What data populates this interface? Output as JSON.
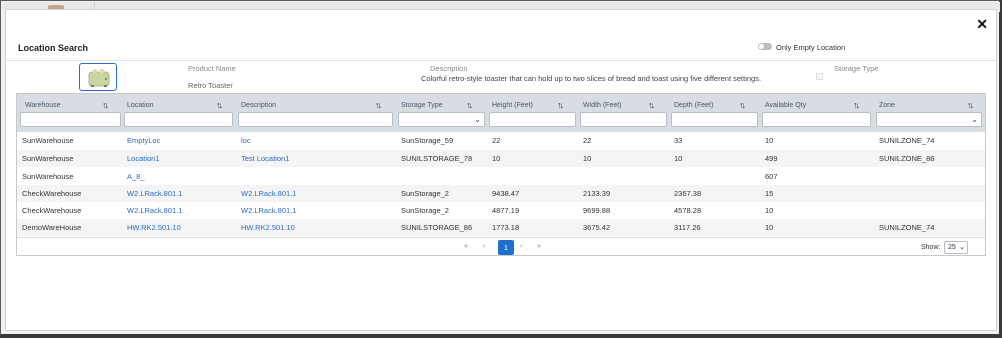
{
  "modal": {
    "title": "Location Search",
    "close_icon": "close-icon",
    "only_empty_location_label": "Only Empty Location"
  },
  "product": {
    "image_icon": "toaster-image",
    "name_label": "Product Name",
    "name_value": "Retro Toaster",
    "description_label": "Description",
    "description_value": "Colorful retro-style toaster that can hold up to two slices of bread and toast using five different settings.",
    "storage_type_label": "Storage Type"
  },
  "grid": {
    "columns": [
      "Warehouse",
      "Location",
      "Description",
      "Storage Type",
      "Height (Feet)",
      "Width (Feet)",
      "Depth (Feet)",
      "Available Qty",
      "Zone"
    ],
    "rows": [
      [
        "SunWarehouse",
        "EmptyLoc",
        "loc",
        "SunStorage_59",
        "22",
        "22",
        "33",
        "10",
        "SUNILZONE_74"
      ],
      [
        "SunWarehouse",
        "Location1",
        "Test Location1",
        "SUNILSTORAGE_78",
        "10",
        "10",
        "10",
        "499",
        "SUNILZONE_86"
      ],
      [
        "SunWarehouse",
        "A_8_",
        "",
        "",
        "",
        "",
        "",
        "607",
        ""
      ],
      [
        "CheckWarehouse",
        "W2.LRack.801.1",
        "W2.LRack.801.1",
        "SunStorage_2",
        "9438.47",
        "2133.39",
        "2367.38",
        "15",
        ""
      ],
      [
        "CheckWarehouse",
        "W2.LRack.801.1",
        "W2.LRack.801.1",
        "SunStorage_2",
        "4877.19",
        "9699.88",
        "4578.28",
        "10",
        ""
      ],
      [
        "DemoWareHouse",
        "HW.RK2.501.10",
        "HW.RK2.501.10",
        "SUNILSTORAGE_86",
        "1773.18",
        "3675.42",
        "3117.26",
        "10",
        "SUNILZONE_74"
      ]
    ]
  },
  "pager": {
    "first": "«",
    "prev": "‹",
    "current_page": "1",
    "next": "›",
    "last": "»",
    "show_label": "Show:",
    "page_size": "25"
  },
  "colors": {
    "accent": "#1f6fcf",
    "link": "#2a6ac8",
    "header_bg": "#d7dde3"
  }
}
